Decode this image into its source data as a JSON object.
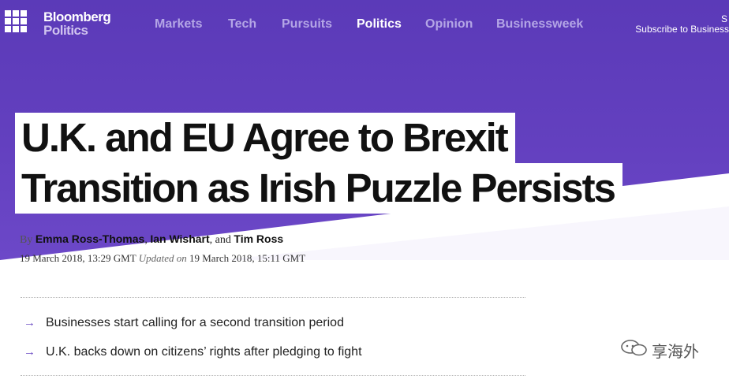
{
  "header": {
    "logo_line1": "Bloomberg",
    "logo_line2": "Politics",
    "nav": [
      "Markets",
      "Tech",
      "Pursuits",
      "Politics",
      "Opinion",
      "Businessweek"
    ],
    "active_nav": "Politics",
    "signin_partial": "S",
    "subscribe_label": "Subscribe to Business"
  },
  "article": {
    "headline_line1": "U.K. and EU Agree to Brexit",
    "headline_line2": "Transition as Irish Puzzle Persists",
    "by_label": "By",
    "authors": [
      "Emma Ross-Thomas",
      "Ian Wishart",
      "Tim Ross"
    ],
    "author_sep1": ",",
    "author_sep2": ", and",
    "published": "19 March 2018, 13:29 GMT",
    "updated_label": "Updated on",
    "updated": "19 March 2018, 15:11 GMT",
    "bullets": [
      "Businesses start calling for a second transition period",
      "U.K. backs down on citizens’ rights after pledging to fight"
    ],
    "bullet_glyph": "→"
  },
  "watermark": {
    "text": "享海外",
    "icon": "wechat-bubble-icon"
  },
  "colors": {
    "hero": "#6340bf",
    "nav_inactive": "#b4a6e6",
    "accent_arrow": "#6a4ac4"
  }
}
